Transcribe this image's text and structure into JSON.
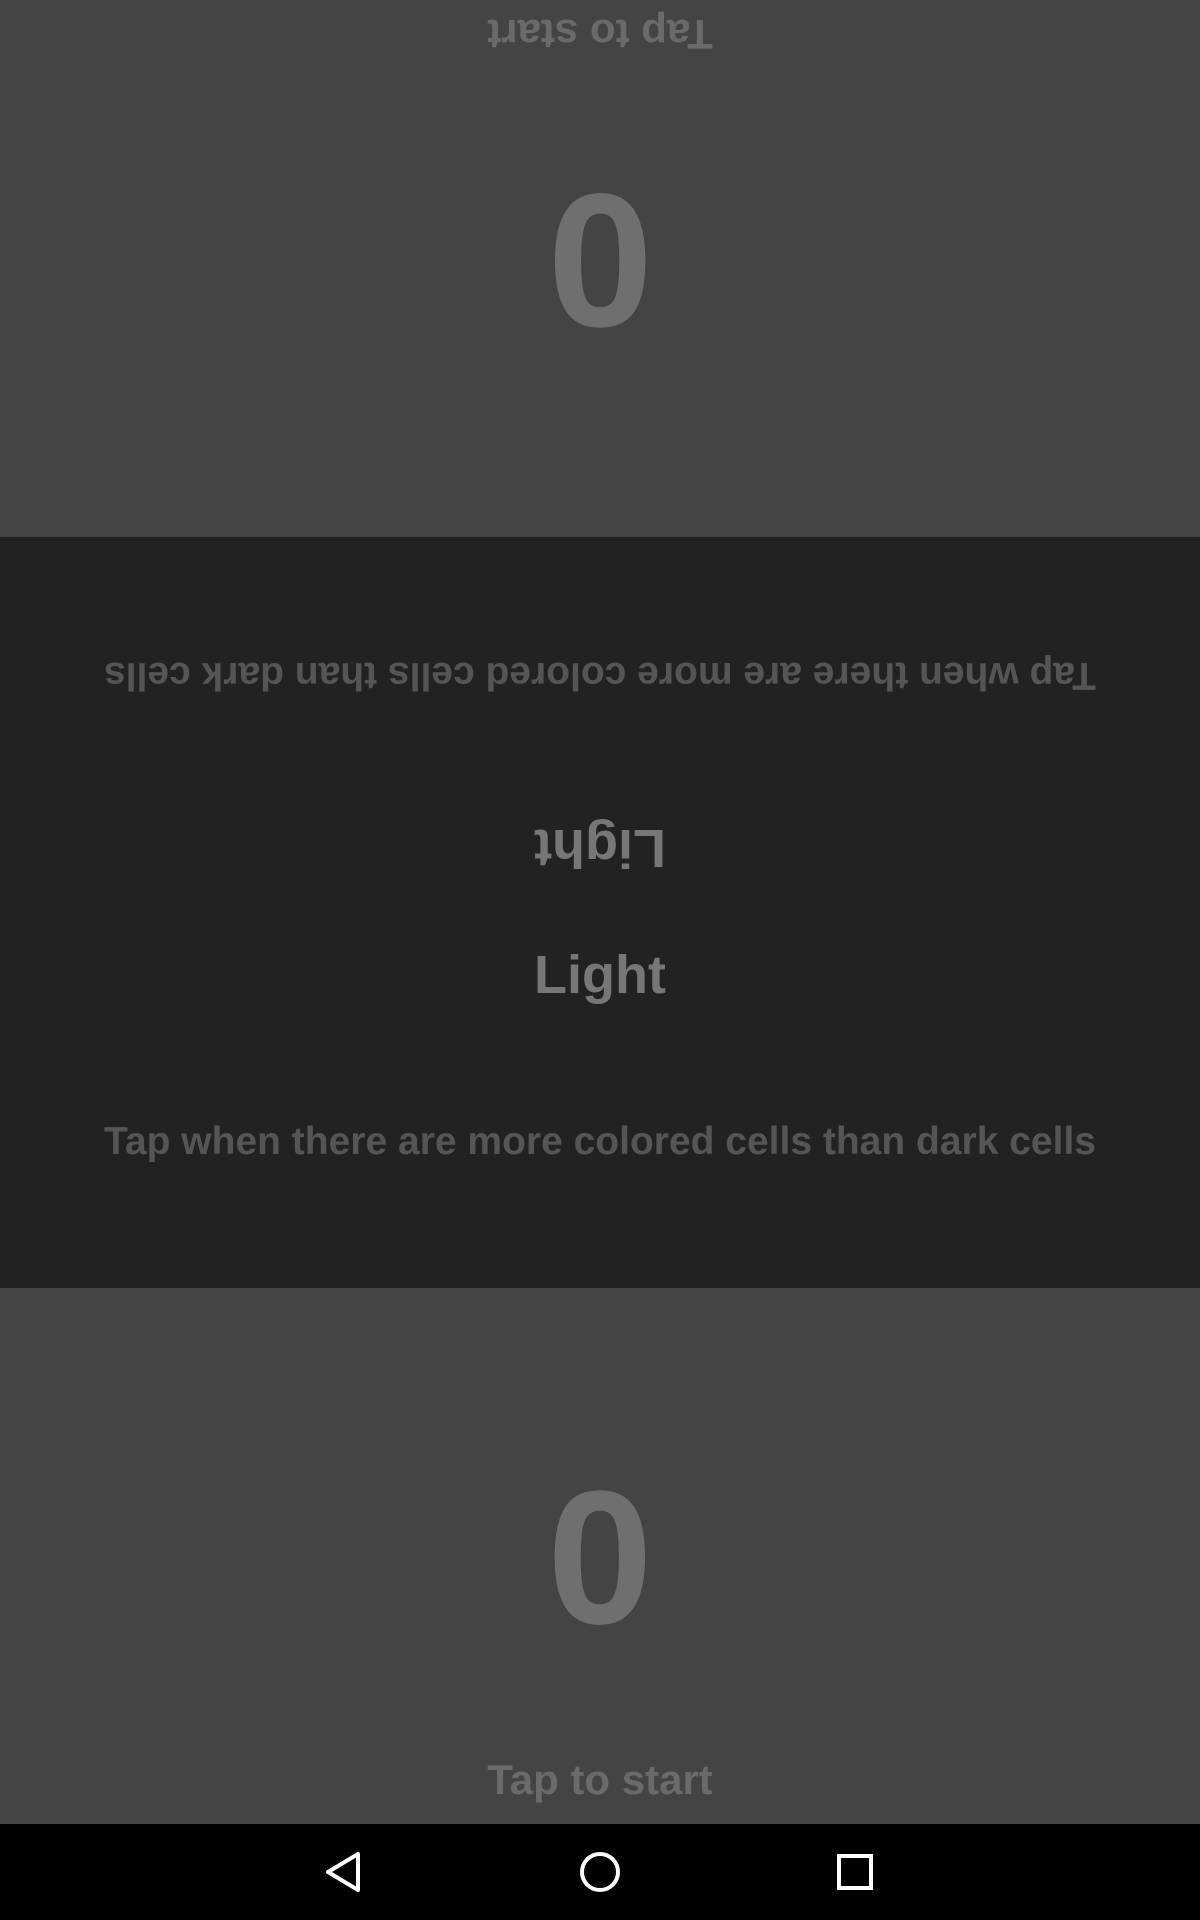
{
  "player_top": {
    "score": "0",
    "prompt": "Tap to start"
  },
  "middle": {
    "instruction_top": "Tap when there are more colored cells than dark cells",
    "mode_top": "Light",
    "mode_bottom": "Light",
    "instruction_bottom": "Tap when there are more colored cells than dark cells"
  },
  "player_bottom": {
    "score": "0",
    "prompt": "Tap to start"
  },
  "navbar": {
    "back_icon": "back-triangle-icon",
    "home_icon": "home-circle-icon",
    "recents_icon": "recents-square-icon"
  },
  "colors": {
    "player_zone_bg": "#444444",
    "middle_bg": "#222222",
    "navbar_bg": "#000000"
  }
}
